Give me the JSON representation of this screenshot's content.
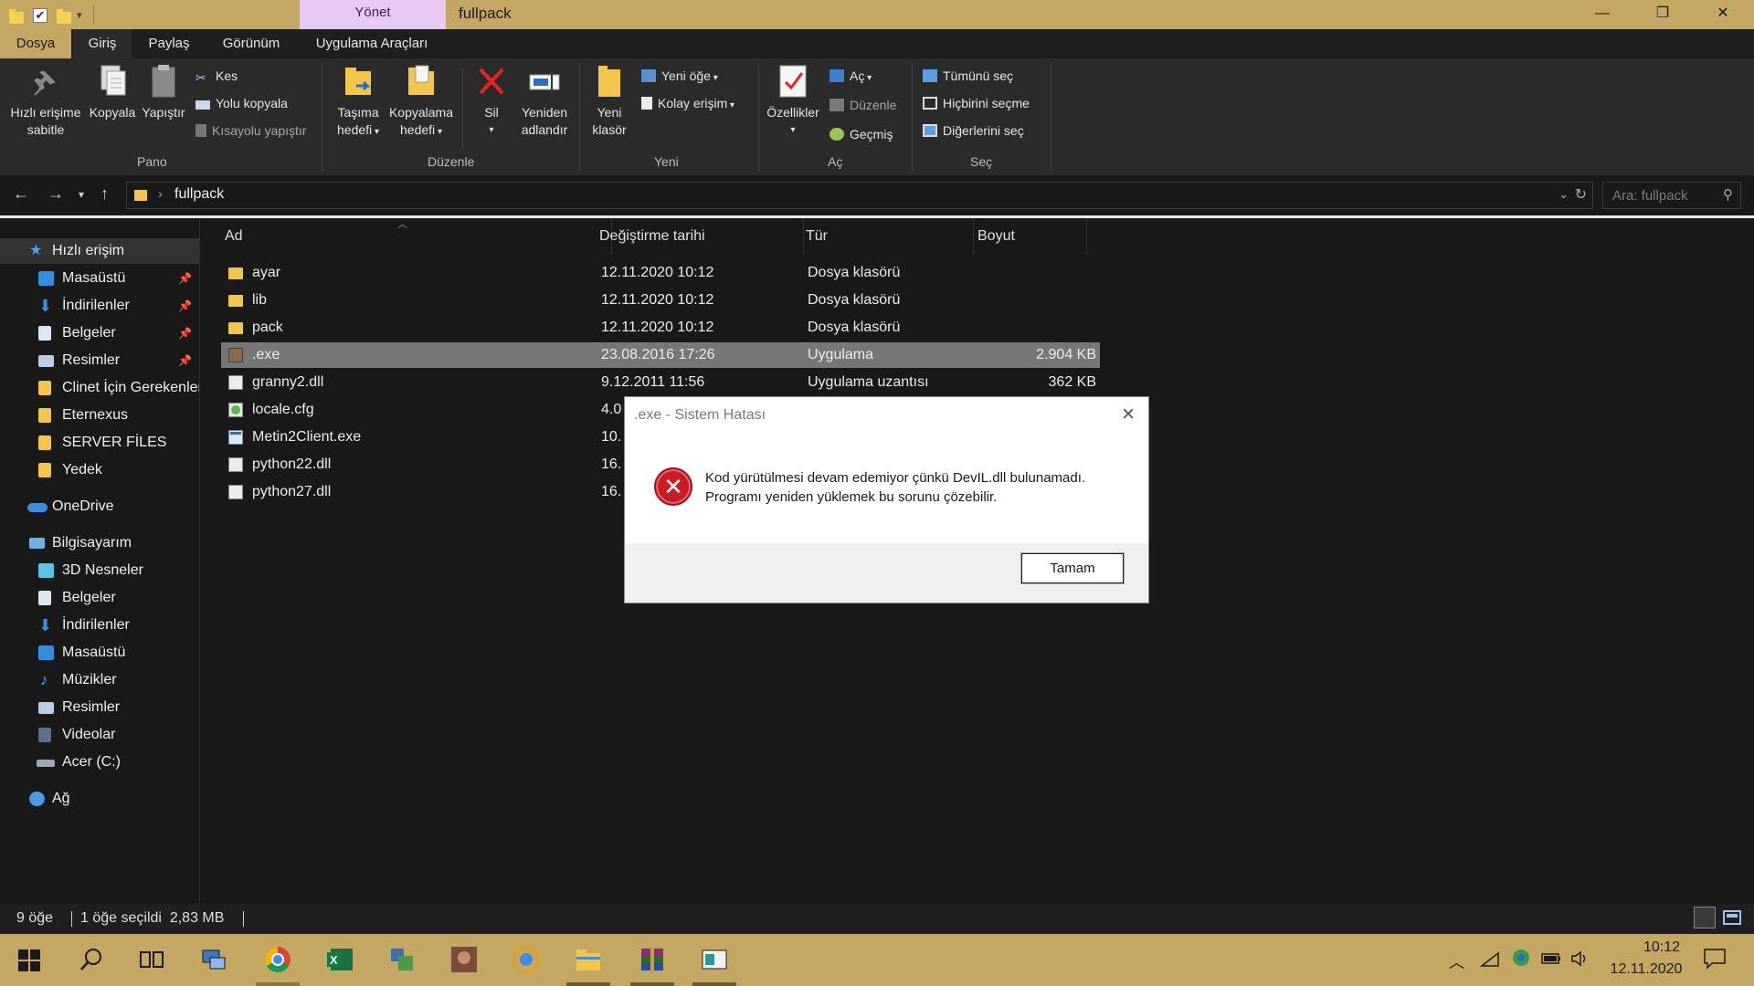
{
  "titlebar": {
    "context_tab": "Yönet",
    "window_title": "fullpack",
    "minimize": "—",
    "maximize": "❐",
    "close": "✕"
  },
  "ribbon_tabs": [
    "Dosya",
    "Giriş",
    "Paylaş",
    "Görünüm",
    "Uygulama Araçları"
  ],
  "ribbon": {
    "pano": {
      "label": "Pano",
      "pin": "Hızlı erişime sabitle",
      "pin_line1": "Hızlı erişime",
      "pin_line2": "sabitle",
      "copy": "Kopyala",
      "paste": "Yapıştır",
      "cut": "Kes",
      "copy_path": "Yolu kopyala",
      "paste_shortcut": "Kısayolu yapıştır"
    },
    "duzenle": {
      "label": "Düzenle",
      "move_line1": "Taşıma",
      "move_line2": "hedefi",
      "copyto_line1": "Kopyalama",
      "copyto_line2": "hedefi",
      "delete": "Sil",
      "rename_line1": "Yeniden",
      "rename_line2": "adlandır"
    },
    "yeni": {
      "label": "Yeni",
      "folder_line1": "Yeni",
      "folder_line2": "klasör",
      "new_item": "Yeni öğe",
      "easy_access": "Kolay erişim"
    },
    "ac": {
      "label": "Aç",
      "properties": "Özellikler",
      "open": "Aç",
      "edit": "Düzenle",
      "history": "Geçmiş"
    },
    "sec": {
      "label": "Seç",
      "select_all": "Tümünü seç",
      "select_none": "Hiçbirini seçme",
      "invert": "Diğerlerini seç"
    }
  },
  "address": {
    "path": "fullpack",
    "search_placeholder": "Ara: fullpack"
  },
  "nav": {
    "quick_access": "Hızlı erişim",
    "qa_items": [
      "Masaüstü",
      "İndirilenler",
      "Belgeler",
      "Resimler",
      "Clinet İçin Gerekenler",
      "Eternexus",
      "SERVER FİLES",
      "Yedek"
    ],
    "onedrive": "OneDrive",
    "computer": "Bilgisayarım",
    "pc_items": [
      "3D Nesneler",
      "Belgeler",
      "İndirilenler",
      "Masaüstü",
      "Müzikler",
      "Resimler",
      "Videolar",
      "Acer (C:)"
    ],
    "network": "Ağ"
  },
  "columns": {
    "name": "Ad",
    "date": "Değiştirme tarihi",
    "type": "Tür",
    "size": "Boyut"
  },
  "files": [
    {
      "name": "ayar",
      "date": "12.11.2020 10:12",
      "type": "Dosya klasörü",
      "size": ""
    },
    {
      "name": "lib",
      "date": "12.11.2020 10:12",
      "type": "Dosya klasörü",
      "size": ""
    },
    {
      "name": "pack",
      "date": "12.11.2020 10:12",
      "type": "Dosya klasörü",
      "size": ""
    },
    {
      "name": ".exe",
      "date": "23.08.2016 17:26",
      "type": "Uygulama",
      "size": "2.904 KB"
    },
    {
      "name": "granny2.dll",
      "date": "9.12.2011 11:56",
      "type": "Uygulama uzantısı",
      "size": "362 KB"
    },
    {
      "name": "locale.cfg",
      "date": "4.0",
      "type": "",
      "size": ""
    },
    {
      "name": "Metin2Client.exe",
      "date": "10.",
      "type": "",
      "size": ""
    },
    {
      "name": "python22.dll",
      "date": "16.",
      "type": "",
      "size": ""
    },
    {
      "name": "python27.dll",
      "date": "16.",
      "type": "",
      "size": ""
    }
  ],
  "dialog": {
    "title": ".exe - Sistem Hatası",
    "message_line1": "Kod yürütülmesi devam edemiyor çünkü DevIL.dll bulunamadı.",
    "message_line2": "Programı yeniden yüklemek bu sorunu çözebilir.",
    "ok": "Tamam"
  },
  "status": {
    "count": "9 öğe",
    "selected": "1 öğe seçildi  2,83 MB"
  },
  "taskbar": {
    "time": "10:12",
    "date": "12.11.2020"
  }
}
